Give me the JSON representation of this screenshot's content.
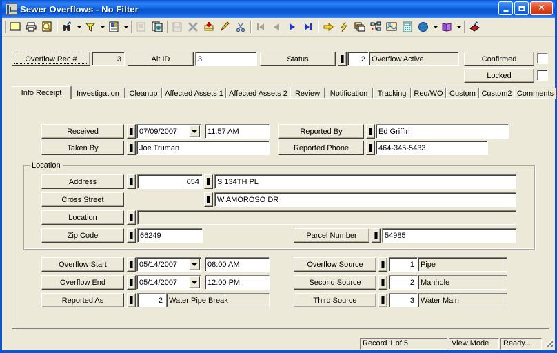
{
  "window": {
    "title": "Sewer Overflows - No Filter",
    "icon": "app-chart-icon",
    "minimize_label": "Minimize",
    "maximize_label": "Maximize",
    "close_label": "Close",
    "accent_color": "#0a56d6",
    "face_color": "#ece9d8"
  },
  "toolbar": {
    "items": [
      {
        "name": "display-form-icon",
        "enabled": true
      },
      {
        "name": "print-icon",
        "enabled": true
      },
      {
        "name": "print-preview-icon",
        "enabled": true
      },
      {
        "name": "find-binoculars-icon",
        "enabled": true
      },
      {
        "name": "find-dropdown-arrow",
        "enabled": true
      },
      {
        "name": "filter-funnel-icon",
        "enabled": true
      },
      {
        "name": "filter-dropdown-arrow",
        "enabled": true
      },
      {
        "name": "report-icon",
        "enabled": true
      },
      {
        "name": "report-dropdown-arrow",
        "enabled": true
      },
      {
        "name": "page-setup-icon",
        "enabled": false
      },
      {
        "name": "copy-record-icon",
        "enabled": true
      },
      {
        "name": "save-icon",
        "enabled": false
      },
      {
        "name": "delete-x-icon",
        "enabled": true
      },
      {
        "name": "post-records-icon",
        "enabled": true
      },
      {
        "name": "edit-pencil-icon",
        "enabled": true
      },
      {
        "name": "cut-scissors-icon",
        "enabled": true
      },
      {
        "name": "first-record-icon",
        "enabled": false
      },
      {
        "name": "previous-record-icon",
        "enabled": false
      },
      {
        "name": "next-record-icon",
        "enabled": true
      },
      {
        "name": "last-record-icon",
        "enabled": true
      },
      {
        "name": "goto-arrow-icon",
        "enabled": true
      },
      {
        "name": "lightning-icon",
        "enabled": true
      },
      {
        "name": "windows-cascade-icon",
        "enabled": true
      },
      {
        "name": "tree-view-icon",
        "enabled": true
      },
      {
        "name": "map-view-icon",
        "enabled": true
      },
      {
        "name": "calculator-icon",
        "enabled": true
      },
      {
        "name": "globe-internet-icon",
        "enabled": true
      },
      {
        "name": "globe-dropdown-arrow",
        "enabled": true
      },
      {
        "name": "help-book-icon",
        "enabled": true
      },
      {
        "name": "help-dropdown-arrow",
        "enabled": true
      },
      {
        "name": "exit-door-icon",
        "enabled": true
      }
    ]
  },
  "header": {
    "rec_label": "Overflow Rec #",
    "rec_value": "3",
    "alt_id_label": "Alt ID",
    "alt_id_value": "3",
    "status_label": "Status",
    "status_code": "2",
    "status_text": "Overflow Active",
    "confirmed_label": "Confirmed",
    "confirmed_checked": false,
    "locked_label": "Locked",
    "locked_checked": false
  },
  "tabs": {
    "active_index": 0,
    "items": [
      {
        "label": "Info Receipt"
      },
      {
        "label": "Investigation"
      },
      {
        "label": "Cleanup"
      },
      {
        "label": "Affected Assets 1"
      },
      {
        "label": "Affected Assets 2"
      },
      {
        "label": "Review"
      },
      {
        "label": "Notification"
      },
      {
        "label": "Tracking"
      },
      {
        "label": "Req/WO"
      },
      {
        "label": "Custom"
      },
      {
        "label": "Custom2"
      },
      {
        "label": "Comments"
      }
    ]
  },
  "form": {
    "received_label": "Received",
    "received_date": "07/09/2007",
    "received_time": "11:57 AM",
    "taken_by_label": "Taken By",
    "taken_by_value": "Joe Truman",
    "reported_by_label": "Reported By",
    "reported_by_value": "Ed Griffin",
    "reported_phone_label": "Reported Phone",
    "reported_phone_value": "464-345-5433",
    "location_group_label": "Location",
    "address_label": "Address",
    "address_number": "654",
    "address_street": "S 134TH PL",
    "cross_street_label": "Cross Street",
    "cross_street_value": "W AMOROSO DR",
    "location_label": "Location",
    "location_value": "",
    "zip_code_label": "Zip Code",
    "zip_code_value": "66249",
    "parcel_number_label": "Parcel Number",
    "parcel_number_value": "54985",
    "overflow_start_label": "Overflow Start",
    "overflow_start_date": "05/14/2007",
    "overflow_start_time": "08:00 AM",
    "overflow_end_label": "Overflow End",
    "overflow_end_date": "05/14/2007",
    "overflow_end_time": "12:00 PM",
    "reported_as_label": "Reported As",
    "reported_as_code": "2",
    "reported_as_text": "Water Pipe Break",
    "overflow_source_label": "Overflow Source",
    "overflow_source_code": "1",
    "overflow_source_text": "Pipe",
    "second_source_label": "Second Source",
    "second_source_code": "2",
    "second_source_text": "Manhole",
    "third_source_label": "Third Source",
    "third_source_code": "3",
    "third_source_text": "Water Main"
  },
  "statusbar": {
    "record_info": "Record 1 of 5",
    "mode": "View Mode",
    "state": "Ready..."
  }
}
